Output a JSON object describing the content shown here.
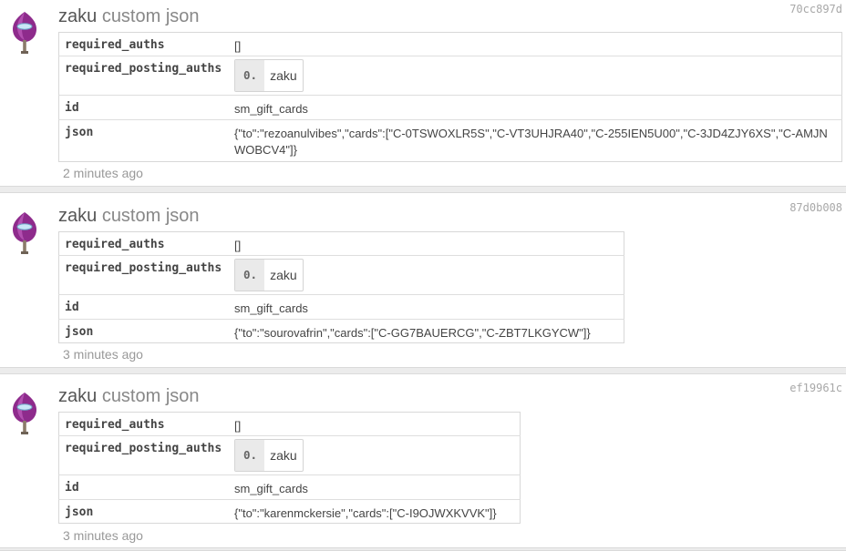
{
  "operations": [
    {
      "account": "zaku",
      "op_label": "custom json",
      "hash": "70cc897d",
      "fields": {
        "required_auths": {
          "key": "required_auths",
          "value": "[]"
        },
        "required_posting_auths": {
          "key": "required_posting_auths",
          "index": "0.",
          "value": "zaku"
        },
        "id": {
          "key": "id",
          "value": "sm_gift_cards"
        },
        "json": {
          "key": "json",
          "value": "{\"to\":\"rezoanulvibes\",\"cards\":[\"C-0TSWOXLR5S\",\"C-VT3UHJRA40\",\"C-255IEN5U00\",\"C-3JD4ZJY6XS\",\"C-AMJNWOBCV4\"]}"
        }
      },
      "time": "2 minutes ago"
    },
    {
      "account": "zaku",
      "op_label": "custom json",
      "hash": "87d0b008",
      "fields": {
        "required_auths": {
          "key": "required_auths",
          "value": "[]"
        },
        "required_posting_auths": {
          "key": "required_posting_auths",
          "index": "0.",
          "value": "zaku"
        },
        "id": {
          "key": "id",
          "value": "sm_gift_cards"
        },
        "json": {
          "key": "json",
          "value": "{\"to\":\"sourovafrin\",\"cards\":[\"C-GG7BAUERCG\",\"C-ZBT7LKGYCW\"]}"
        }
      },
      "time": "3 minutes ago"
    },
    {
      "account": "zaku",
      "op_label": "custom json",
      "hash": "ef19961c",
      "fields": {
        "required_auths": {
          "key": "required_auths",
          "value": "[]"
        },
        "required_posting_auths": {
          "key": "required_posting_auths",
          "index": "0.",
          "value": "zaku"
        },
        "id": {
          "key": "id",
          "value": "sm_gift_cards"
        },
        "json": {
          "key": "json",
          "value": "{\"to\":\"karenmckersie\",\"cards\":[\"C-I9OJWXKVVK\"]}"
        }
      },
      "time": "3 minutes ago"
    }
  ],
  "avatar_icon": "purple-balloon-avatar-icon"
}
